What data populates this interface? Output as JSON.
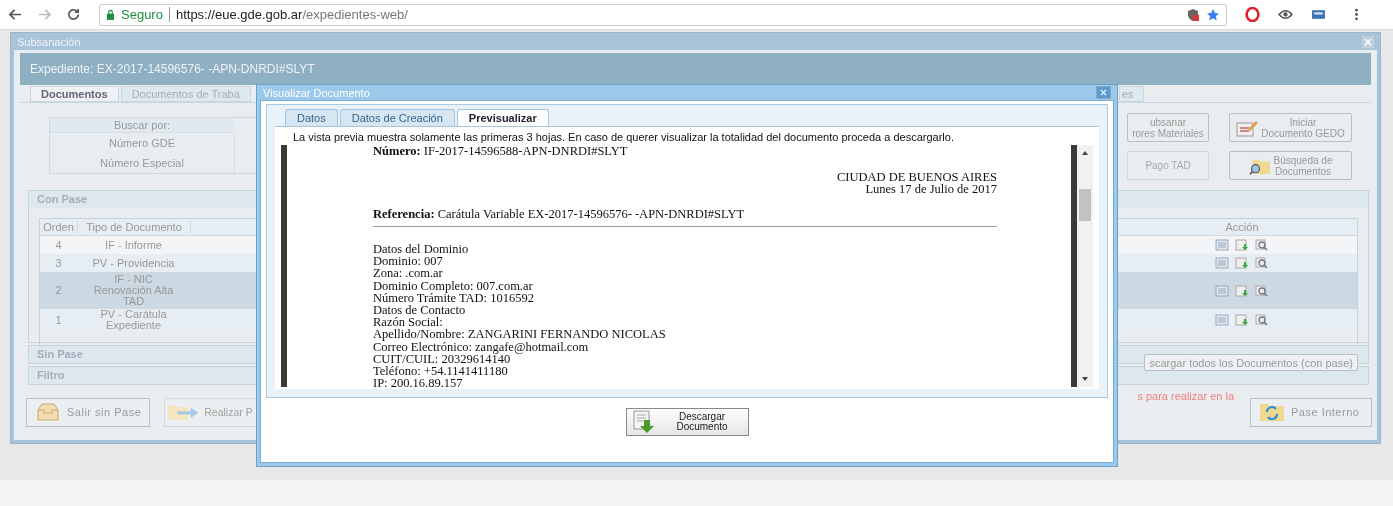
{
  "browser": {
    "secure_label": "Seguro",
    "url_host": "https://eue.gde.gob.ar",
    "url_path": "/expedientes-web/"
  },
  "window": {
    "title": "Subsanación"
  },
  "expediente": "Expediente: EX-2017-14596576- -APN-DNRDI#SLYT",
  "tabs": [
    {
      "label": "Documentos",
      "selected": true
    },
    {
      "label": "Documentos de Traba",
      "selected": false
    },
    {
      "label": "es",
      "selected": false
    }
  ],
  "search": {
    "header": "Buscar por:",
    "options": [
      "Número GDE",
      "Número Especial"
    ]
  },
  "actions": [
    {
      "lines": [
        "ubsanar",
        "rores Materiales"
      ],
      "disabled": false
    },
    {
      "lines": [
        "Iniciar",
        "Documento GEDO"
      ],
      "disabled": false
    },
    {
      "lines": [
        "Pago TAD"
      ],
      "disabled": true
    },
    {
      "lines": [
        "Búsqueda de",
        "Documentos"
      ],
      "disabled": false
    }
  ],
  "con_pase": {
    "title": "Con Pase",
    "columns": [
      "Orden",
      "Tipo de Documento",
      "Acción"
    ],
    "rows": [
      {
        "orden": "4",
        "tipo": "IF - Informe",
        "selected": false
      },
      {
        "orden": "3",
        "tipo": "PV - Providencia",
        "selected": false
      },
      {
        "orden": "2",
        "tipo": "IF - NIC\nRenovación Alta\nTAD",
        "selected": true
      },
      {
        "orden": "1",
        "tipo": "PV - Carátula\nExpediente",
        "selected": false
      }
    ],
    "download_all": "scargar todos los Documentos (con pase)"
  },
  "sections": [
    "Sin Pase",
    "Filtro"
  ],
  "footer": {
    "buttons": [
      {
        "label": "Salir sin Pase",
        "disabled": false
      },
      {
        "label": "Realizar P",
        "disabled": true
      }
    ],
    "notice": "s para realizar en la",
    "pase_button": {
      "label": "Pase Interno"
    }
  },
  "modal": {
    "title": "Visualizar Documento",
    "tabs": [
      {
        "label": "Datos",
        "selected": false
      },
      {
        "label": "Datos de Creación",
        "selected": false
      },
      {
        "label": "Previsualizar",
        "selected": true
      }
    ],
    "notice": "La vista previa muestra solamente las primeras 3 hojas. En caso de querer visualizar la totalidad del documento proceda a descargarlo.",
    "document": {
      "numero": "**Número:** IF-2017-14596588-APN-DNRDI#SLYT",
      "city": "CIUDAD DE BUENOS AIRES",
      "date": "Lunes 17 de Julio de 2017",
      "referencia": "**Referencia:** Carátula Variable EX-2017-14596576- -APN-DNRDI#SLYT",
      "lines": [
        "Datos del Dominio",
        "Dominio: 007",
        "Zona: .com.ar",
        "Dominio Completo: 007.com.ar",
        "Número Trámite TAD: 1016592",
        "Datos de Contacto",
        "Razón Social:",
        "Apellido/Nombre: ZANGARINI FERNANDO NICOLAS",
        "Correo Electrónico: zangafe@hotmail.com",
        "CUIT/CUIL: 20329614140",
        "Teléfono: +54.1141411180",
        "IP: 200.16.89.157"
      ]
    },
    "download_button": [
      "Descargar",
      "Documento"
    ]
  }
}
